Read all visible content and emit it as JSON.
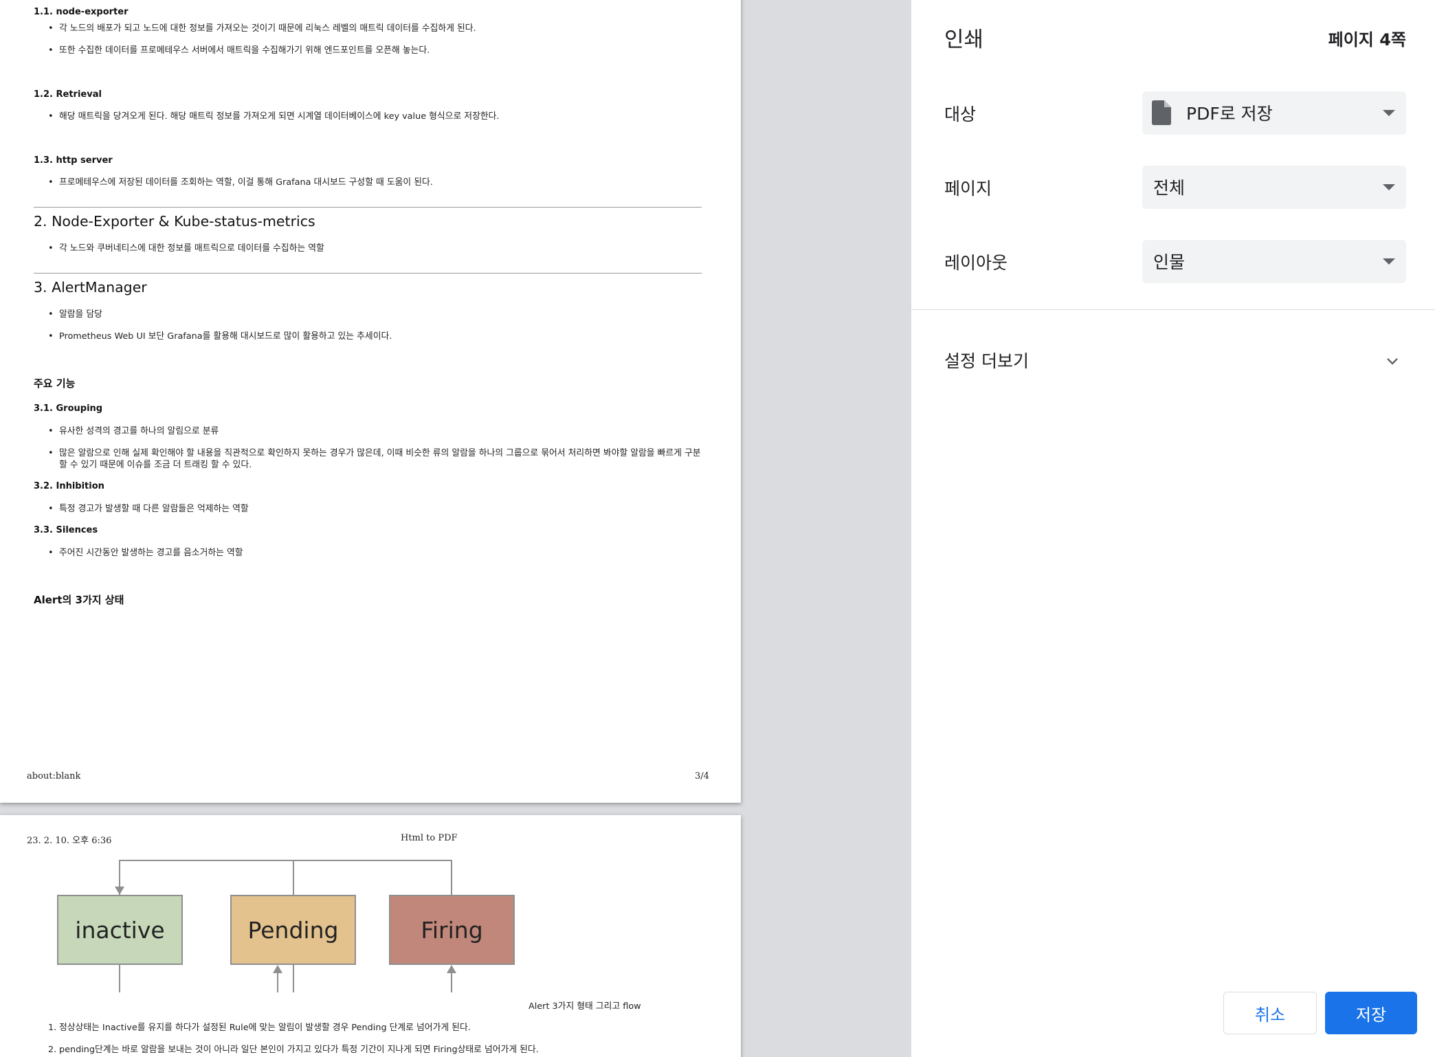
{
  "document": {
    "page3": {
      "s1_1": "1.1. node-exporter",
      "s1_1_items": [
        "각 노드의 배포가 되고 노드에 대한 정보를 가져오는 것이기 때문에 리눅스 레벨의 매트릭 데이터를 수집하게 된다.",
        "또한 수집한 데이터를 프로메테우스 서버에서 매트릭을 수집해가기 위해 엔드포인트를 오픈해 놓는다."
      ],
      "s1_2": "1.2. Retrieval",
      "s1_2_items": [
        "해당 매트릭을 당겨오게 된다. 해당 매트릭 정보를 가져오게 되면 시계열 데이터베이스에 key value 형식으로 저장한다."
      ],
      "s1_3": "1.3. http server",
      "s1_3_items": [
        "프로메테우스에 저장된 데이터를 조회하는 역할, 이걸 통해 Grafana 대시보드 구성할 때 도움이 된다."
      ],
      "s2": "2. Node-Exporter & Kube-status-metrics",
      "s2_items": [
        "각 노드와 쿠버네티스에 대한 정보를 매트릭으로 데이터를 수집하는 역할"
      ],
      "s3": "3. AlertManager",
      "s3_items": [
        "알람을 담당",
        "Prometheus Web UI 보단 Grafana를 활용해 대시보드로 많이 활용하고 있는 추세이다."
      ],
      "main_features": "주요 기능",
      "s3_1": "3.1. Grouping",
      "s3_1_items": [
        "유사한 성격의 경고를 하나의 알림으로 분류",
        "많은 알람으로 인해 실제 확인해야 할 내용을 직관적으로 확인하지 못하는 경우가 많은데, 이때 비슷한 류의 알람을 하나의 그룹으로 묶어서 처리하면 봐야할 알람을 빠르게 구분할 수 있기 때문에 이슈를 조금 더 트래킹 할 수 있다."
      ],
      "s3_2": "3.2. Inhibition",
      "s3_2_items": [
        "특정 경고가 발생할 때 다른 알람들은 억제하는 역할"
      ],
      "s3_3": "3.3. Silences",
      "s3_3_items": [
        "주어진 시간동안 발생하는 경고를 음소거하는 역할"
      ],
      "alert_states": "Alert의 3가지 상태",
      "footer_left": "about:blank",
      "footer_right": "3/4"
    },
    "page4": {
      "header_left": "23. 2. 10. 오후 6:36",
      "header_center": "Html to PDF",
      "states": [
        {
          "label": "inactive",
          "color": "#c6d8b9"
        },
        {
          "label": "Pending",
          "color": "#e3c28e"
        },
        {
          "label": "Firing",
          "color": "#c0877a"
        }
      ],
      "caption": "Alert 3가지 형태 그리고 flow",
      "list": [
        {
          "num": "1.",
          "text": "정상상태는 Inactive를 유지를 하다가 설정된 Rule에 맞는 알림이 발생할 경우 Pending 단계로 넘어가게 된다."
        },
        {
          "num": "2.",
          "text": "pending단계는 바로 알람을 보내는 것이 아니라 일단 본인이 가지고 있다가 특정 기간이 지나게 되면 Firing상태로 넘어가게 된다."
        }
      ]
    }
  },
  "print_panel": {
    "title": "인쇄",
    "page_count": "페이지 4쪽",
    "destination_label": "대상",
    "destination_value": "PDF로 저장",
    "destination_icon": "file-icon",
    "pages_label": "페이지",
    "pages_value": "전체",
    "layout_label": "레이아웃",
    "layout_value": "인물",
    "more_settings": "설정 더보기",
    "cancel": "취소",
    "save": "저장",
    "accent": "#1a73e8"
  }
}
